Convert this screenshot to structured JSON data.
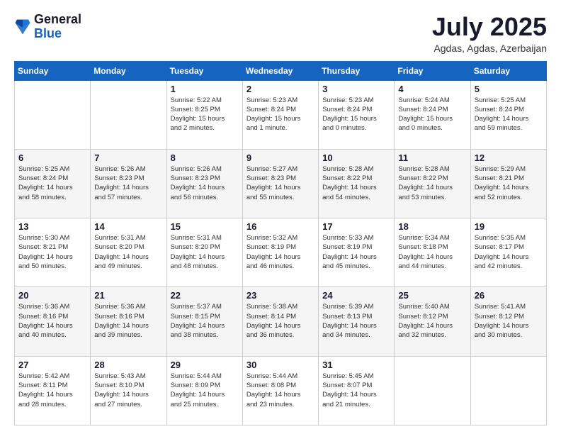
{
  "logo": {
    "general": "General",
    "blue": "Blue"
  },
  "title": "July 2025",
  "location": "Agdas, Agdas, Azerbaijan",
  "weekdays": [
    "Sunday",
    "Monday",
    "Tuesday",
    "Wednesday",
    "Thursday",
    "Friday",
    "Saturday"
  ],
  "weeks": [
    [
      {
        "day": "",
        "info": ""
      },
      {
        "day": "",
        "info": ""
      },
      {
        "day": "1",
        "info": "Sunrise: 5:22 AM\nSunset: 8:25 PM\nDaylight: 15 hours\nand 2 minutes."
      },
      {
        "day": "2",
        "info": "Sunrise: 5:23 AM\nSunset: 8:24 PM\nDaylight: 15 hours\nand 1 minute."
      },
      {
        "day": "3",
        "info": "Sunrise: 5:23 AM\nSunset: 8:24 PM\nDaylight: 15 hours\nand 0 minutes."
      },
      {
        "day": "4",
        "info": "Sunrise: 5:24 AM\nSunset: 8:24 PM\nDaylight: 15 hours\nand 0 minutes."
      },
      {
        "day": "5",
        "info": "Sunrise: 5:25 AM\nSunset: 8:24 PM\nDaylight: 14 hours\nand 59 minutes."
      }
    ],
    [
      {
        "day": "6",
        "info": "Sunrise: 5:25 AM\nSunset: 8:24 PM\nDaylight: 14 hours\nand 58 minutes."
      },
      {
        "day": "7",
        "info": "Sunrise: 5:26 AM\nSunset: 8:23 PM\nDaylight: 14 hours\nand 57 minutes."
      },
      {
        "day": "8",
        "info": "Sunrise: 5:26 AM\nSunset: 8:23 PM\nDaylight: 14 hours\nand 56 minutes."
      },
      {
        "day": "9",
        "info": "Sunrise: 5:27 AM\nSunset: 8:23 PM\nDaylight: 14 hours\nand 55 minutes."
      },
      {
        "day": "10",
        "info": "Sunrise: 5:28 AM\nSunset: 8:22 PM\nDaylight: 14 hours\nand 54 minutes."
      },
      {
        "day": "11",
        "info": "Sunrise: 5:28 AM\nSunset: 8:22 PM\nDaylight: 14 hours\nand 53 minutes."
      },
      {
        "day": "12",
        "info": "Sunrise: 5:29 AM\nSunset: 8:21 PM\nDaylight: 14 hours\nand 52 minutes."
      }
    ],
    [
      {
        "day": "13",
        "info": "Sunrise: 5:30 AM\nSunset: 8:21 PM\nDaylight: 14 hours\nand 50 minutes."
      },
      {
        "day": "14",
        "info": "Sunrise: 5:31 AM\nSunset: 8:20 PM\nDaylight: 14 hours\nand 49 minutes."
      },
      {
        "day": "15",
        "info": "Sunrise: 5:31 AM\nSunset: 8:20 PM\nDaylight: 14 hours\nand 48 minutes."
      },
      {
        "day": "16",
        "info": "Sunrise: 5:32 AM\nSunset: 8:19 PM\nDaylight: 14 hours\nand 46 minutes."
      },
      {
        "day": "17",
        "info": "Sunrise: 5:33 AM\nSunset: 8:19 PM\nDaylight: 14 hours\nand 45 minutes."
      },
      {
        "day": "18",
        "info": "Sunrise: 5:34 AM\nSunset: 8:18 PM\nDaylight: 14 hours\nand 44 minutes."
      },
      {
        "day": "19",
        "info": "Sunrise: 5:35 AM\nSunset: 8:17 PM\nDaylight: 14 hours\nand 42 minutes."
      }
    ],
    [
      {
        "day": "20",
        "info": "Sunrise: 5:36 AM\nSunset: 8:16 PM\nDaylight: 14 hours\nand 40 minutes."
      },
      {
        "day": "21",
        "info": "Sunrise: 5:36 AM\nSunset: 8:16 PM\nDaylight: 14 hours\nand 39 minutes."
      },
      {
        "day": "22",
        "info": "Sunrise: 5:37 AM\nSunset: 8:15 PM\nDaylight: 14 hours\nand 38 minutes."
      },
      {
        "day": "23",
        "info": "Sunrise: 5:38 AM\nSunset: 8:14 PM\nDaylight: 14 hours\nand 36 minutes."
      },
      {
        "day": "24",
        "info": "Sunrise: 5:39 AM\nSunset: 8:13 PM\nDaylight: 14 hours\nand 34 minutes."
      },
      {
        "day": "25",
        "info": "Sunrise: 5:40 AM\nSunset: 8:12 PM\nDaylight: 14 hours\nand 32 minutes."
      },
      {
        "day": "26",
        "info": "Sunrise: 5:41 AM\nSunset: 8:12 PM\nDaylight: 14 hours\nand 30 minutes."
      }
    ],
    [
      {
        "day": "27",
        "info": "Sunrise: 5:42 AM\nSunset: 8:11 PM\nDaylight: 14 hours\nand 28 minutes."
      },
      {
        "day": "28",
        "info": "Sunrise: 5:43 AM\nSunset: 8:10 PM\nDaylight: 14 hours\nand 27 minutes."
      },
      {
        "day": "29",
        "info": "Sunrise: 5:44 AM\nSunset: 8:09 PM\nDaylight: 14 hours\nand 25 minutes."
      },
      {
        "day": "30",
        "info": "Sunrise: 5:44 AM\nSunset: 8:08 PM\nDaylight: 14 hours\nand 23 minutes."
      },
      {
        "day": "31",
        "info": "Sunrise: 5:45 AM\nSunset: 8:07 PM\nDaylight: 14 hours\nand 21 minutes."
      },
      {
        "day": "",
        "info": ""
      },
      {
        "day": "",
        "info": ""
      }
    ]
  ]
}
